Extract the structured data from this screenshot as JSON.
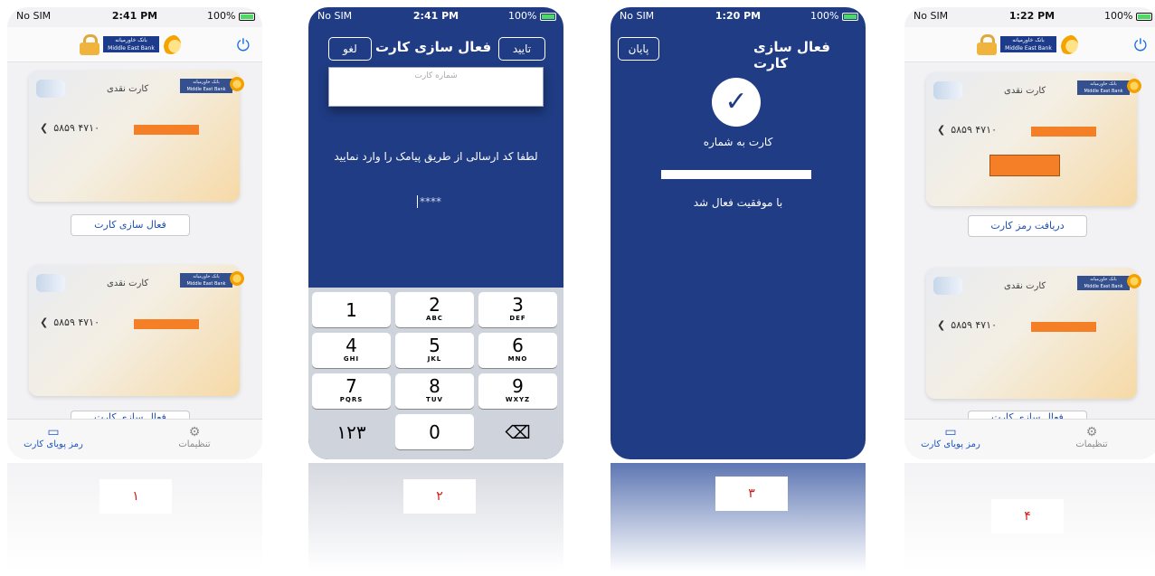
{
  "status_bars": [
    {
      "left": "No SIM",
      "time": "2:41 PM",
      "right": "100%"
    },
    {
      "left": "No SIM",
      "time": "2:41 PM",
      "right": "100%"
    },
    {
      "left": "No SIM",
      "time": "1:20 PM",
      "right": "100%"
    },
    {
      "left": "No SIM",
      "time": "1:22 PM",
      "right": "100%"
    }
  ],
  "bank": {
    "name_fa": "بانک خاورمیانه",
    "name_en": "Middle East Bank"
  },
  "card": {
    "type": "کارت نقدی",
    "number": "۵۸۵۹ ۴۷۱۰"
  },
  "screen1": {
    "activate_button": "فعال سازی کارت",
    "activate_button_2": "فعال سازی کارت"
  },
  "tabs": {
    "dynamic_password": "رمز پویای کارت",
    "settings": "تنظیمات"
  },
  "screen2": {
    "title": "فعال سازی کارت",
    "confirm": "تایید",
    "cancel": "لغو",
    "card_number_placeholder": "شماره کارت",
    "prompt": "لطفا کد ارسالی از طریق پیامک را وارد نمایید",
    "pin_placeholder": "****",
    "keys": [
      {
        "n": "1",
        "s": ""
      },
      {
        "n": "2",
        "s": "ABC"
      },
      {
        "n": "3",
        "s": "DEF"
      },
      {
        "n": "4",
        "s": "GHI"
      },
      {
        "n": "5",
        "s": "JKL"
      },
      {
        "n": "6",
        "s": "MNO"
      },
      {
        "n": "7",
        "s": "PQRS"
      },
      {
        "n": "8",
        "s": "TUV"
      },
      {
        "n": "9",
        "s": "WXYZ"
      },
      {
        "n": "۱۲۳",
        "s": ""
      },
      {
        "n": "0",
        "s": ""
      },
      {
        "n": "⌫",
        "s": ""
      }
    ]
  },
  "screen3": {
    "title": "فعال سازی کارت",
    "end": "پایان",
    "card_label": "کارت به شماره",
    "success": "با موفقیت فعال شد"
  },
  "screen4": {
    "get_password_button": "دریافت رمز کارت",
    "activate_button": "فعال سازی کارت"
  },
  "step_labels": [
    "۱",
    "۲",
    "۳",
    "۴"
  ],
  "colors": {
    "accent_dark": "#1f3c84",
    "accent_link": "#1d4fb0",
    "redaction": "#f47f27",
    "step_label": "#d21a1a"
  }
}
